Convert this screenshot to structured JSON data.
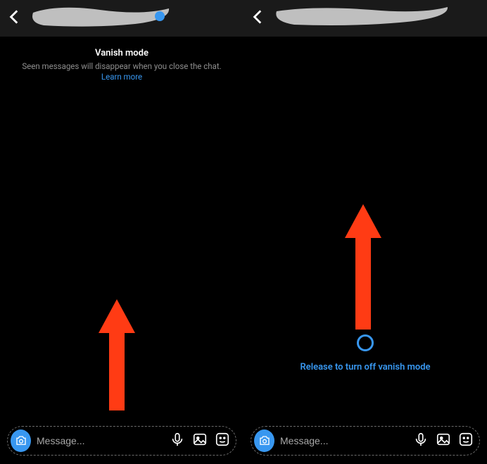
{
  "left": {
    "vanish_title": "Vanish mode",
    "vanish_subtitle": "Seen messages will disappear when you close the chat.",
    "learn_more": "Learn more",
    "composer_placeholder": "Message..."
  },
  "right": {
    "release_label": "Release to turn off vanish mode",
    "composer_placeholder": "Message..."
  },
  "colors": {
    "accent": "#3897f0",
    "arrow": "#ff3b14"
  }
}
